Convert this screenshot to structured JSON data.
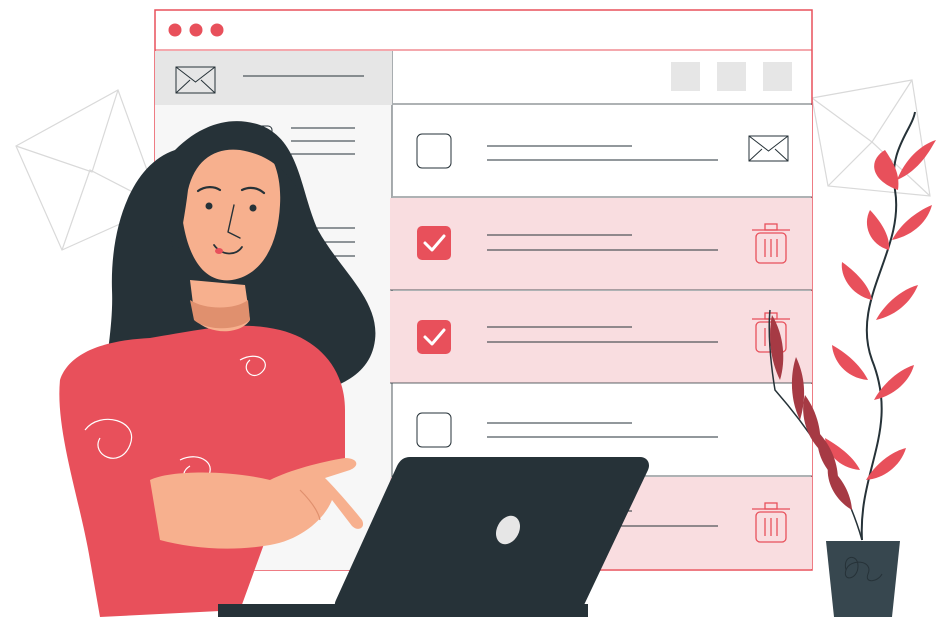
{
  "window": {
    "controls": [
      "dot",
      "dot",
      "dot"
    ],
    "sidebar": {
      "items": [
        {
          "icon": "envelope-icon",
          "active": true
        },
        {
          "icon": "chat-icon",
          "active": false
        },
        {
          "icon": "text-lines",
          "active": false
        }
      ]
    },
    "toolbar": {
      "buttons": [
        "square",
        "square",
        "square"
      ]
    },
    "mail_rows": [
      {
        "checked": false,
        "selected": false,
        "action_icon": "envelope-icon"
      },
      {
        "checked": true,
        "selected": true,
        "action_icon": "trash-icon"
      },
      {
        "checked": true,
        "selected": true,
        "action_icon": "trash-icon"
      },
      {
        "checked": false,
        "selected": false,
        "action_icon": "none"
      },
      {
        "checked": false,
        "selected": true,
        "action_icon": "trash-icon"
      }
    ]
  },
  "colors": {
    "accent": "#e8505b",
    "accent_light": "#f9dde0",
    "hair": "#263238",
    "skin": "#f7b08e",
    "laptop": "#263238",
    "pot": "#37474f",
    "leaf_dark": "#a63a44",
    "panel_border": "#e8505b",
    "gray": "#e6e6e6"
  }
}
